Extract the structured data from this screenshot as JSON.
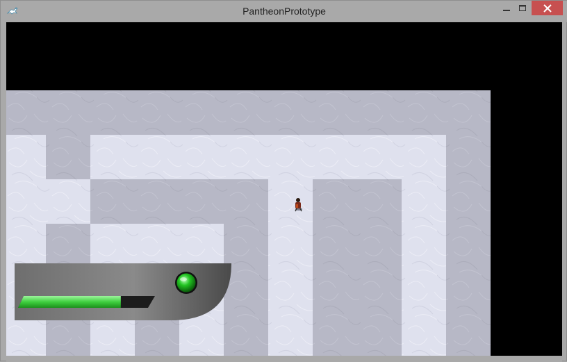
{
  "window": {
    "title": "PantheonPrototype",
    "icons": {
      "app": "pegasus-app-icon",
      "minimize": "minimize-icon",
      "maximize": "maximize-icon",
      "close": "close-icon"
    },
    "close_color": "#c75050"
  },
  "game": {
    "background": "#000000",
    "floor_color": "#dfe1ee",
    "wall_color": "#b7b8c6",
    "player": {
      "icon": "player-character-icon"
    }
  },
  "hud": {
    "health_fraction": 0.77,
    "health_color": "#33cc33",
    "status_light": "green-status-light-icon",
    "status_color": "#22bb22"
  }
}
